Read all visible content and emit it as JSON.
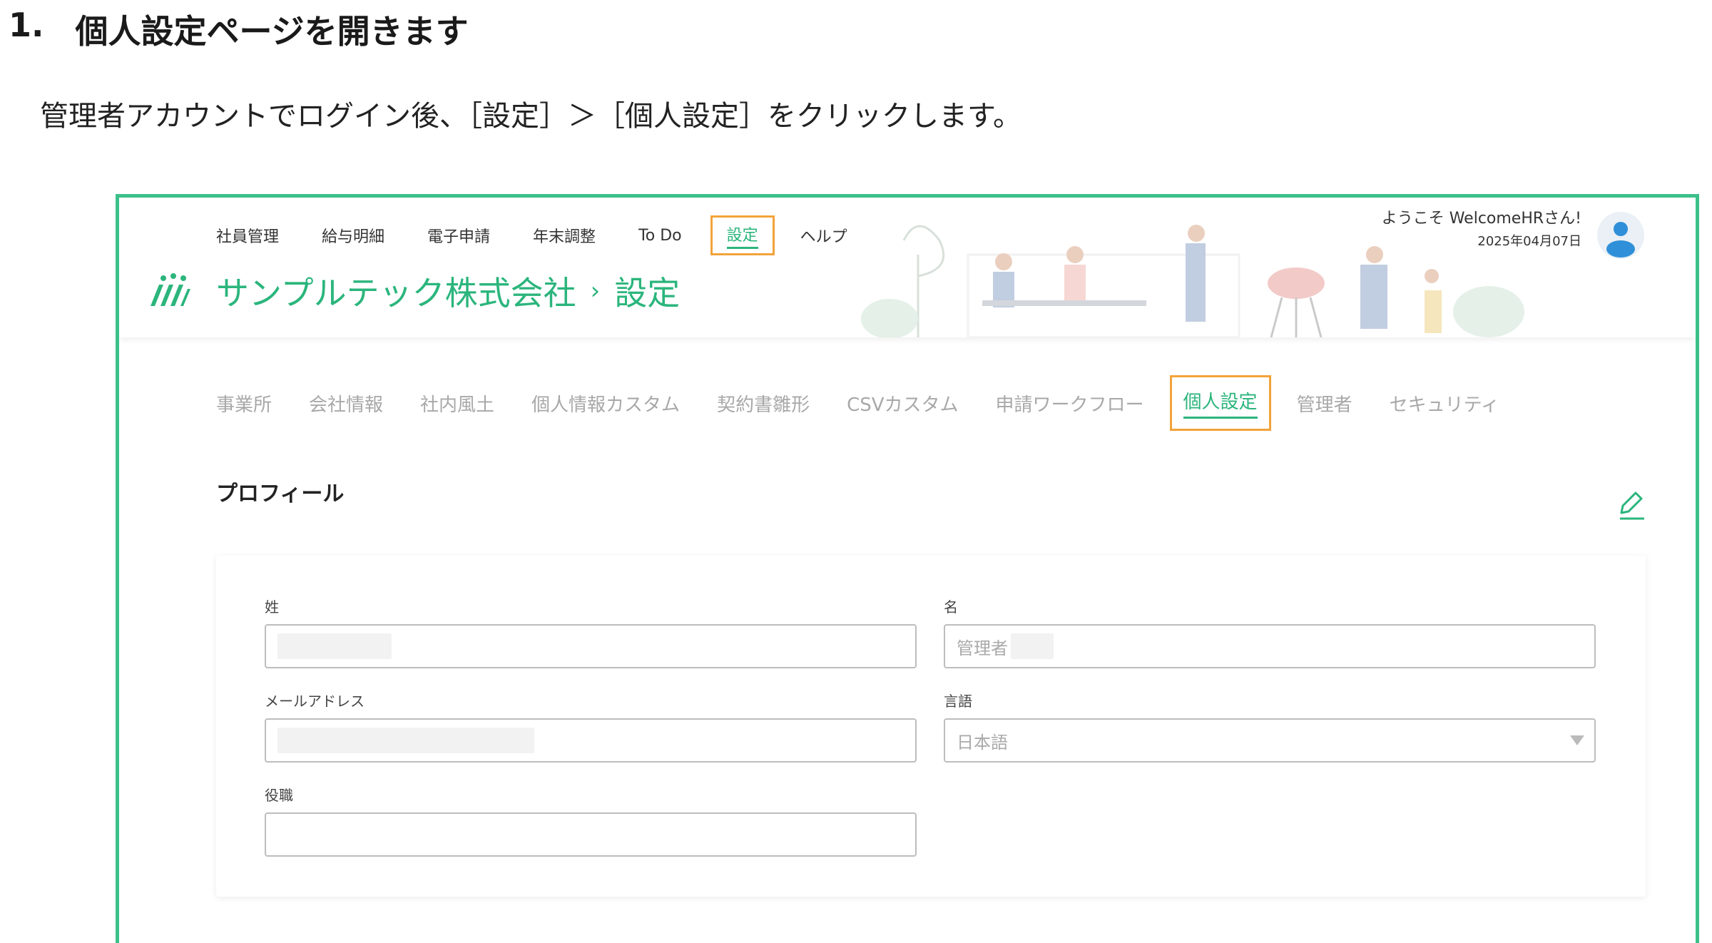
{
  "doc": {
    "step_number": "1.",
    "step_title": "個人設定ページを開きます",
    "description": "管理者アカウントでログイン後、［設定］＞［個人設定］をクリックします。"
  },
  "topnav": {
    "items": [
      {
        "label": "社員管理"
      },
      {
        "label": "給与明細"
      },
      {
        "label": "電子申請"
      },
      {
        "label": "年末調整"
      },
      {
        "label": "To Do"
      },
      {
        "label": "設定",
        "active": true
      },
      {
        "label": "ヘルプ"
      }
    ]
  },
  "header": {
    "company": "サンプルテック株式会社",
    "separator": "›",
    "page": "設定",
    "welcome": "ようこそ WelcomeHRさん!",
    "date": "2025年04月07日"
  },
  "subnav": {
    "items": [
      {
        "label": "事業所"
      },
      {
        "label": "会社情報"
      },
      {
        "label": "社内風土"
      },
      {
        "label": "個人情報カスタム"
      },
      {
        "label": "契約書雛形"
      },
      {
        "label": "CSVカスタム"
      },
      {
        "label": "申請ワークフロー"
      },
      {
        "label": "個人設定",
        "active": true
      },
      {
        "label": "管理者"
      },
      {
        "label": "セキュリティ"
      }
    ]
  },
  "profile": {
    "title": "プロフィール",
    "last_name_label": "姓",
    "last_name_value": "",
    "first_name_label": "名",
    "first_name_value": "管理者",
    "email_label": "メールアドレス",
    "email_value": "",
    "language_label": "言語",
    "language_value": "日本語",
    "position_label": "役職",
    "position_value": ""
  },
  "colors": {
    "accent": "#2bb57c",
    "frame": "#3cc08a",
    "highlight": "#f2a33a"
  },
  "icons": {
    "logo": "company-logo",
    "avatar": "user-avatar-icon",
    "edit": "pencil-icon",
    "dropdown": "caret-down-icon"
  }
}
